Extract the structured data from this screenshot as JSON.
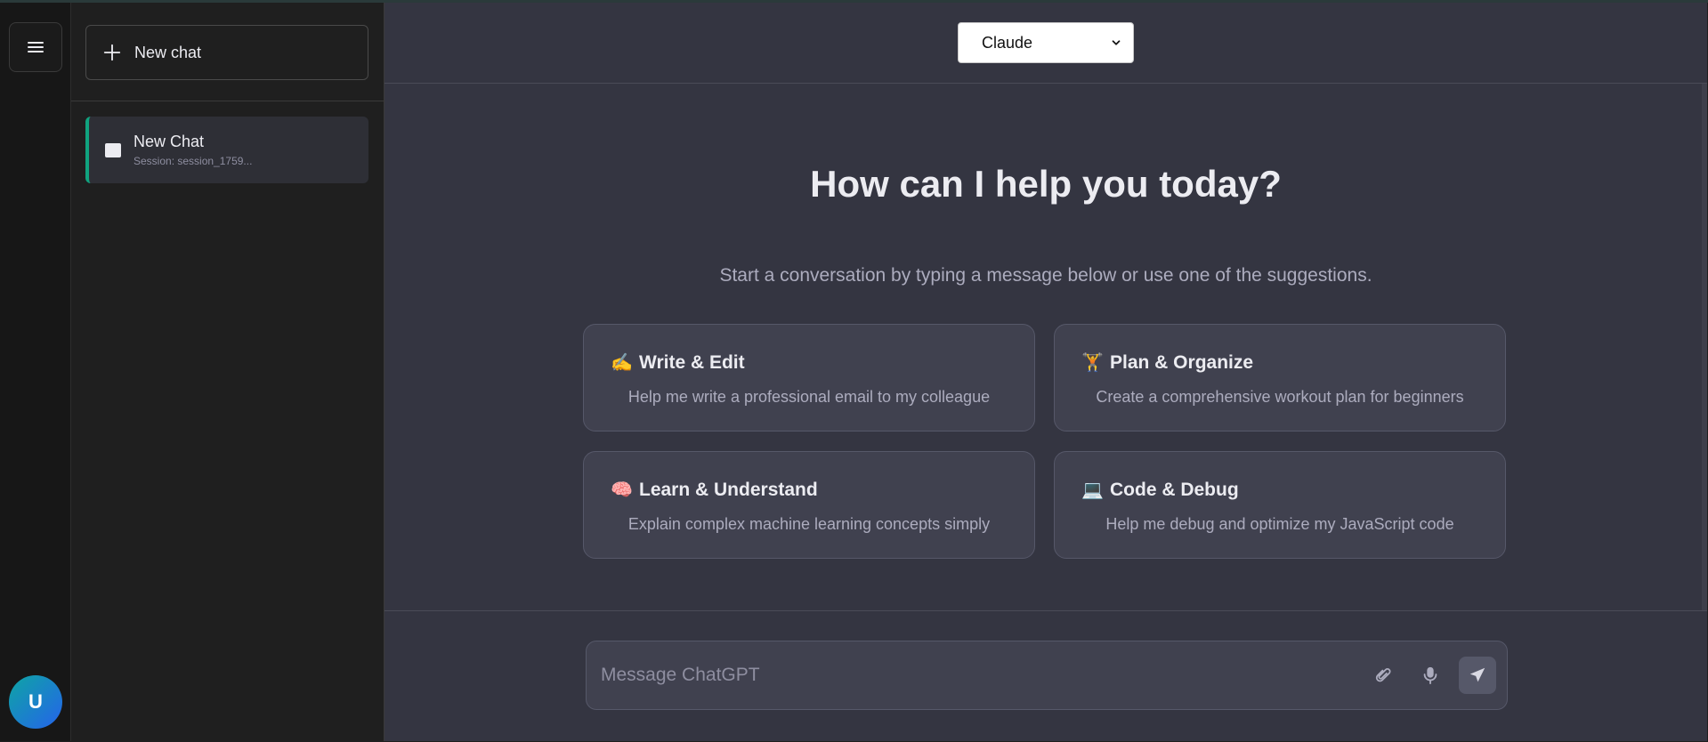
{
  "sidebar": {
    "new_chat_label": "New chat",
    "chats": [
      {
        "title": "New Chat",
        "subtitle": "Session: session_1759..."
      }
    ]
  },
  "user": {
    "avatar_initial": "U"
  },
  "header": {
    "model_selected": "Claude"
  },
  "hero": {
    "title": "How can I help you today?",
    "subtitle": "Start a conversation by typing a message below or use one of the suggestions."
  },
  "suggestions": [
    {
      "emoji": "✍️",
      "title": "Write & Edit",
      "description": "Help me write a professional email to my colleague"
    },
    {
      "emoji": "🏋️",
      "title": "Plan & Organize",
      "description": "Create a comprehensive workout plan for beginners"
    },
    {
      "emoji": "🧠",
      "title": "Learn & Understand",
      "description": "Explain complex machine learning concepts simply"
    },
    {
      "emoji": "💻",
      "title": "Code & Debug",
      "description": "Help me debug and optimize my JavaScript code"
    }
  ],
  "composer": {
    "placeholder": "Message ChatGPT",
    "value": ""
  },
  "icons": {
    "menu": "hamburger-menu-icon",
    "new_chat": "plus-icon",
    "chat": "chat-square-icon",
    "dropdown": "chevron-down-icon",
    "attach": "paperclip-icon",
    "mic": "microphone-icon",
    "send": "send-arrow-icon"
  },
  "colors": {
    "accent": "#10a37f",
    "main_bg": "#343541",
    "sidebar_bg": "#1f1f1f",
    "card_bg": "#40414f"
  }
}
